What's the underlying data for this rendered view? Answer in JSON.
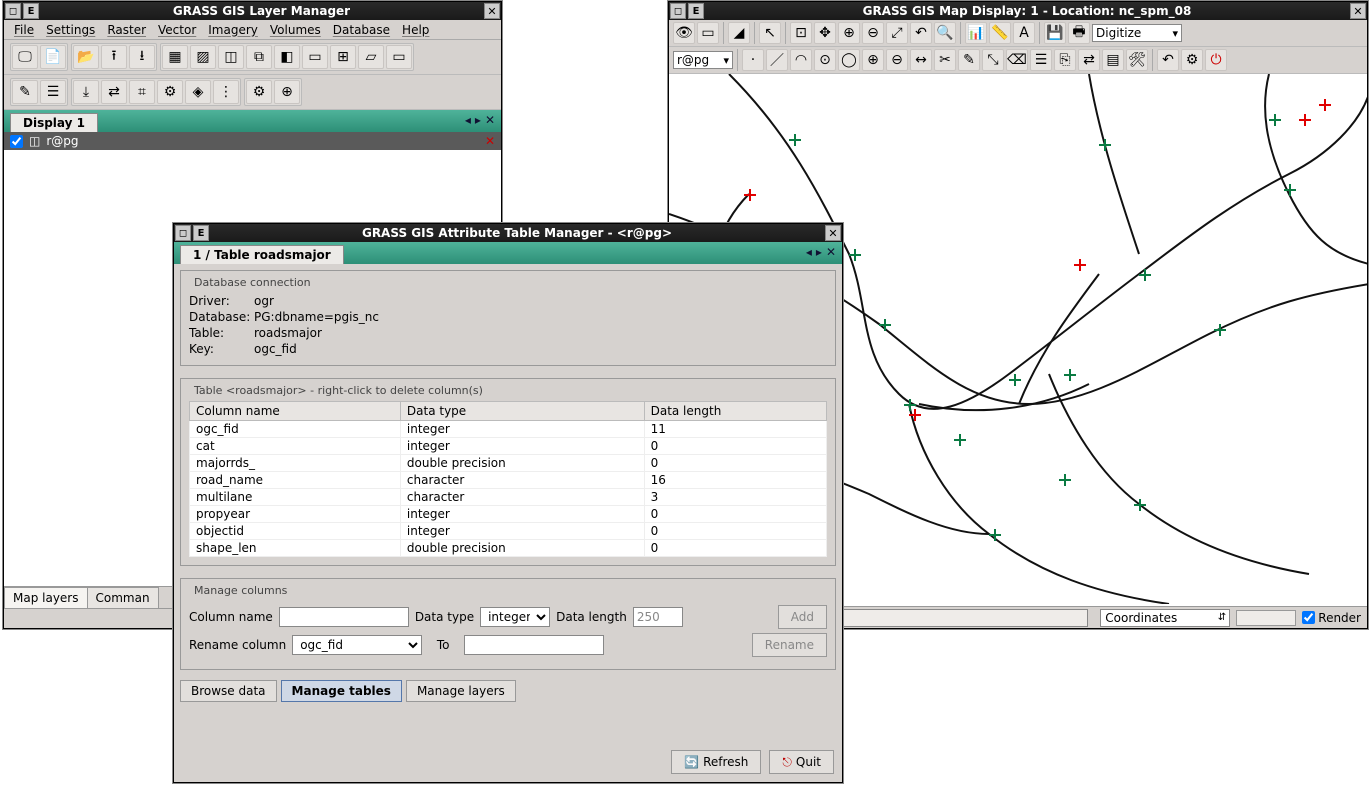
{
  "layerManager": {
    "title": "GRASS GIS Layer Manager",
    "menus": [
      "File",
      "Settings",
      "Raster",
      "Vector",
      "Imagery",
      "Volumes",
      "Database",
      "Help"
    ],
    "displayTab": "Display 1",
    "layer": "r@pg",
    "bottomTabs": [
      "Map layers",
      "Comman"
    ]
  },
  "mapDisplay": {
    "title": "GRASS GIS Map Display: 1  - Location: nc_spm_08",
    "modeSelect": "Digitize",
    "layerSelect": "r@pg",
    "coordLabel": "Coordinates",
    "renderLabel": "Render"
  },
  "attr": {
    "title": "GRASS GIS Attribute Table Manager - <r@pg>",
    "tabLabel": "1 / Table roadsmajor",
    "dbconn": {
      "legend": "Database connection",
      "driverLabel": "Driver:",
      "driver": "ogr",
      "databaseLabel": "Database:",
      "database": "PG:dbname=pgis_nc",
      "tableLabel": "Table:",
      "table": "roadsmajor",
      "keyLabel": "Key:",
      "key": "ogc_fid"
    },
    "tableLegend": "Table <roadsmajor> - right-click to delete column(s)",
    "headers": {
      "col": "Column name",
      "type": "Data type",
      "len": "Data length"
    },
    "rows": [
      {
        "col": "ogc_fid",
        "type": "integer",
        "len": "11"
      },
      {
        "col": "cat",
        "type": "integer",
        "len": "0"
      },
      {
        "col": "majorrds_",
        "type": "double precision",
        "len": "0"
      },
      {
        "col": "road_name",
        "type": "character",
        "len": "16"
      },
      {
        "col": "multilane",
        "type": "character",
        "len": "3"
      },
      {
        "col": "propyear",
        "type": "integer",
        "len": "0"
      },
      {
        "col": "objectid",
        "type": "integer",
        "len": "0"
      },
      {
        "col": "shape_len",
        "type": "double precision",
        "len": "0"
      }
    ],
    "manage": {
      "legend": "Manage columns",
      "colNameLabel": "Column name",
      "dataTypeLabel": "Data type",
      "dataTypeValue": "integer",
      "dataLenLabel": "Data length",
      "dataLenValue": "250",
      "addLabel": "Add",
      "renameLabel": "Rename column",
      "renameValue": "ogc_fid",
      "toLabel": "To",
      "renameBtn": "Rename"
    },
    "tabs": [
      "Browse data",
      "Manage tables",
      "Manage layers"
    ],
    "refresh": "Refresh",
    "quit": "Quit"
  }
}
